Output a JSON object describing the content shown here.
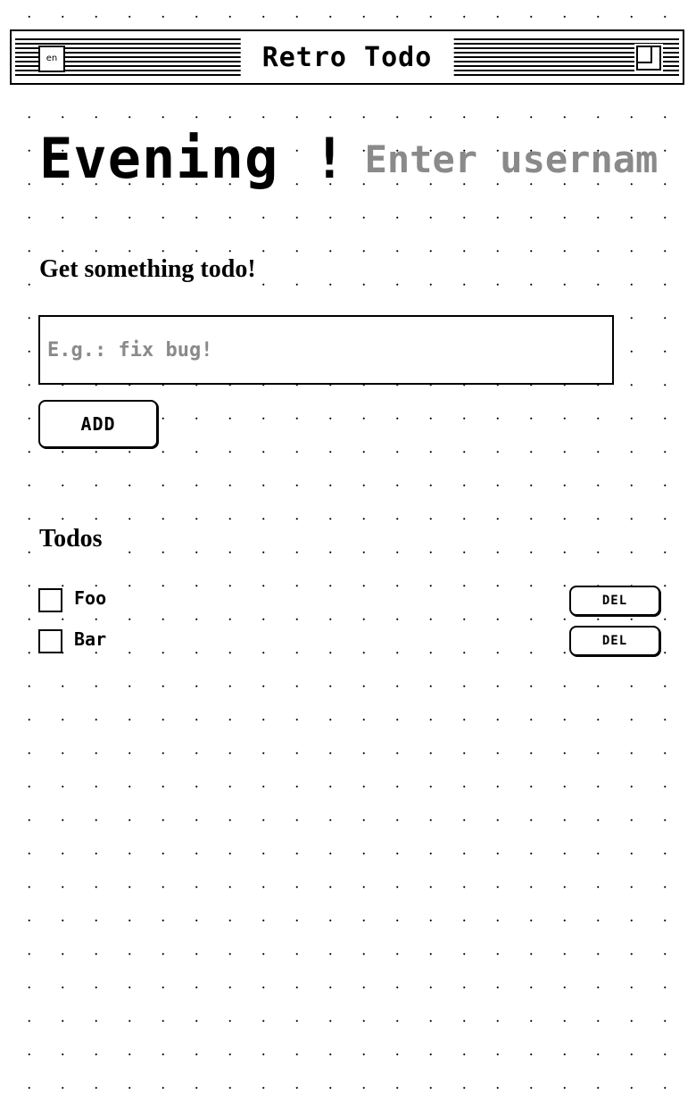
{
  "window": {
    "title": "Retro Todo",
    "language_label": "en"
  },
  "greeting": {
    "text": "Evening !",
    "username_placeholder": "Enter username"
  },
  "new_todo": {
    "heading": "Get something todo!",
    "input_placeholder": "E.g.: fix bug!",
    "add_label": "ADD"
  },
  "todos": {
    "heading": "Todos",
    "items": [
      {
        "label": "Foo",
        "done": false,
        "delete_label": "DEL"
      },
      {
        "label": "Bar",
        "done": false,
        "delete_label": "DEL"
      }
    ]
  },
  "colors": {
    "background": "#ffffff",
    "foreground": "#000000",
    "placeholder": "#8a8a8a"
  }
}
